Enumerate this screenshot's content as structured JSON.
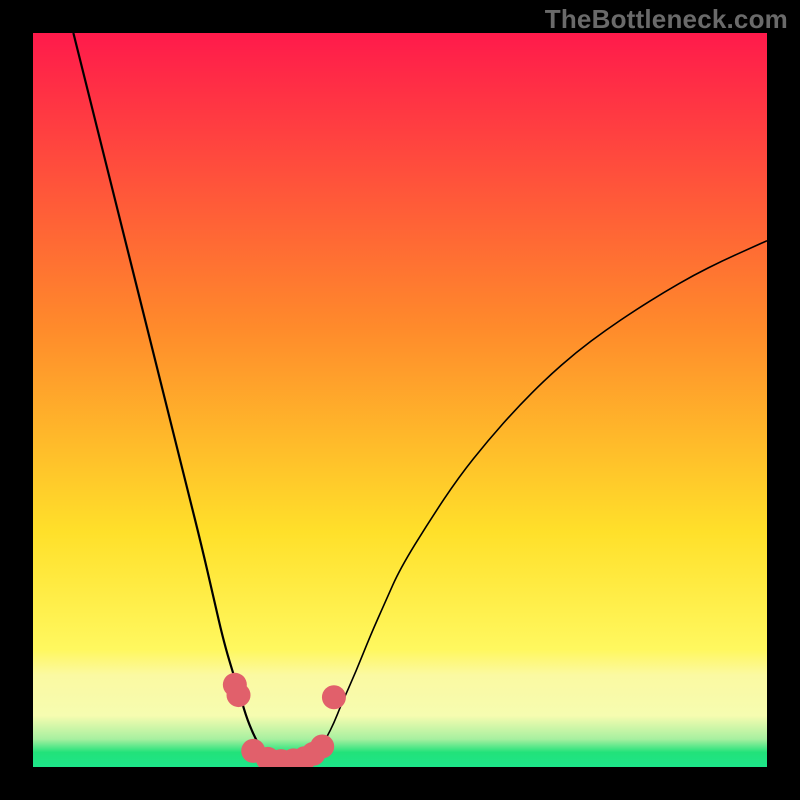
{
  "attribution": "TheBottleneck.com",
  "colors": {
    "top": "#ff1a4b",
    "mid1": "#ff6a2b",
    "mid2": "#ffe02a",
    "band_soft": "#fbf9a2",
    "band_green": "#22e27a",
    "bottom_green": "#1de589",
    "curve": "#000000",
    "dot_fill": "#e1606b",
    "dot_stroke": "#e1606b"
  },
  "chart_data": {
    "type": "line",
    "title": "",
    "xlabel": "",
    "ylabel": "",
    "xlim": [
      0,
      100
    ],
    "ylim": [
      0,
      100
    ],
    "curve_left": {
      "name": "bottleneck-left",
      "pts": [
        [
          5.5,
          100
        ],
        [
          7,
          94
        ],
        [
          9,
          86
        ],
        [
          11,
          78
        ],
        [
          13,
          70
        ],
        [
          15,
          62
        ],
        [
          17,
          54
        ],
        [
          19,
          46
        ],
        [
          21,
          38
        ],
        [
          23,
          30
        ],
        [
          24.5,
          23.5
        ],
        [
          26,
          17
        ],
        [
          27.5,
          12
        ],
        [
          28,
          10.5
        ],
        [
          29,
          7
        ],
        [
          30,
          4.5
        ],
        [
          31,
          2.6
        ],
        [
          32,
          1.3
        ],
        [
          33,
          0.6
        ],
        [
          34,
          0.3
        ],
        [
          35,
          0.3
        ]
      ]
    },
    "curve_right": {
      "name": "bottleneck-right",
      "pts": [
        [
          35,
          0.3
        ],
        [
          36,
          0.4
        ],
        [
          37,
          0.7
        ],
        [
          38,
          1.3
        ],
        [
          39,
          2.4
        ],
        [
          40,
          4.0
        ],
        [
          41,
          6.0
        ],
        [
          42,
          8.5
        ],
        [
          44,
          13
        ],
        [
          46,
          18
        ],
        [
          48,
          22.5
        ],
        [
          50,
          27
        ],
        [
          54,
          33.5
        ],
        [
          58,
          39.5
        ],
        [
          62,
          44.5
        ],
        [
          66,
          49
        ],
        [
          70,
          53
        ],
        [
          74,
          56.5
        ],
        [
          78,
          59.5
        ],
        [
          82,
          62.2
        ],
        [
          86,
          64.7
        ],
        [
          90,
          67
        ],
        [
          94,
          69
        ],
        [
          98,
          70.8
        ],
        [
          100,
          71.7
        ]
      ]
    },
    "dots": [
      {
        "x": 27.5,
        "y": 11.2,
        "r": 12
      },
      {
        "x": 28.0,
        "y": 9.8,
        "r": 12
      },
      {
        "x": 30.0,
        "y": 2.2,
        "r": 12
      },
      {
        "x": 32.0,
        "y": 1.1,
        "r": 12
      },
      {
        "x": 33.8,
        "y": 0.8,
        "r": 12
      },
      {
        "x": 35.5,
        "y": 0.9,
        "r": 12
      },
      {
        "x": 37.0,
        "y": 1.2,
        "r": 12
      },
      {
        "x": 38.2,
        "y": 1.8,
        "r": 12
      },
      {
        "x": 39.4,
        "y": 2.8,
        "r": 12
      },
      {
        "x": 41.0,
        "y": 9.5,
        "r": 12
      }
    ]
  }
}
